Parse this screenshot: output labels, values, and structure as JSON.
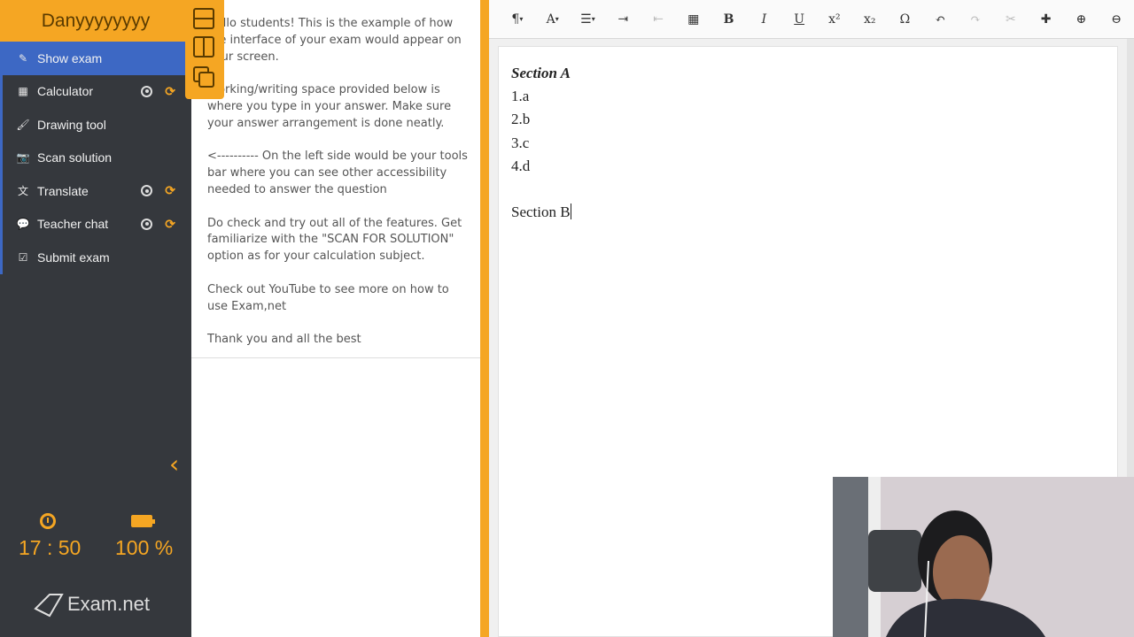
{
  "student": {
    "name": "Danyyyyyyyy"
  },
  "sidebar": {
    "items": [
      {
        "label": "Show exam",
        "icon": "edit-icon",
        "active": true
      },
      {
        "label": "Calculator",
        "icon": "calculator-icon",
        "controls": true
      },
      {
        "label": "Drawing tool",
        "icon": "brush-icon"
      },
      {
        "label": "Scan solution",
        "icon": "camera-icon"
      },
      {
        "label": "Translate",
        "icon": "translate-icon",
        "controls": true
      },
      {
        "label": "Teacher chat",
        "icon": "chat-icon",
        "controls": true
      },
      {
        "label": "Submit exam",
        "icon": "checkbox-icon"
      }
    ],
    "collapse_icon": "chevron-left-icon"
  },
  "status": {
    "time": "17 : 50",
    "battery": "100 %"
  },
  "logo": {
    "text": "Exam.net"
  },
  "instructions": {
    "paragraphs": [
      "Hello students! This is the example of how the interface of your exam would appear on your screen.",
      "Working/writing space provided below is where you type in your answer. Make sure your answer arrangement is done neatly.",
      "<---------- On the left side would be your tools bar where you can see other accessibility needed to answer the question",
      "Do check and try out all of the features. Get familiarize with the \"SCAN FOR SOLUTION\" option as for your calculation subject.",
      "Check out YouTube to see more on how to use Exam,net",
      "Thank you and all the best"
    ]
  },
  "toolbar": {
    "paragraph": "¶",
    "font": "A",
    "bold": "B",
    "italic": "I",
    "underline": "U",
    "superscript": "x²",
    "subscript": "x₂",
    "omega": "Ω"
  },
  "editor": {
    "lines": [
      "Section A",
      "1.a",
      "2.b",
      "3.c",
      "4.d",
      "",
      "Section B"
    ]
  },
  "colors": {
    "accent": "#f5a623",
    "active_nav": "#3d68c4",
    "sidebar_bg": "#35383d"
  }
}
